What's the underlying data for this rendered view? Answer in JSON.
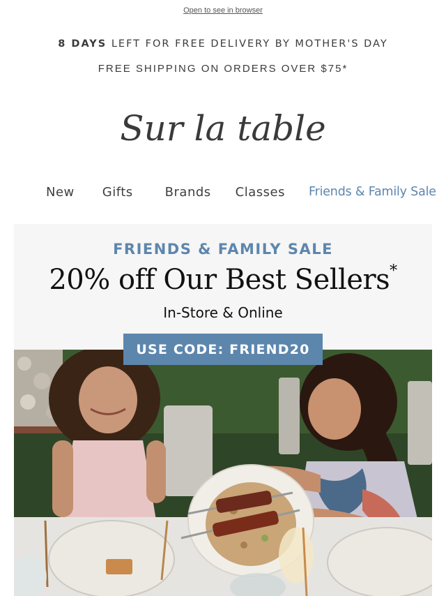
{
  "preheader": {
    "open_in_browser": "Open to see in browser"
  },
  "promo": {
    "days_bold": "8 DAYS",
    "days_rest": " LEFT FOR FREE DELIVERY BY MOTHER'S DAY",
    "shipping": "FREE SHIPPING ON ORDERS OVER $75*"
  },
  "brand": {
    "logo_text": "Sur la table"
  },
  "nav": {
    "items": [
      {
        "label": "New"
      },
      {
        "label": "Gifts"
      },
      {
        "label": "Brands"
      },
      {
        "label": "Classes"
      },
      {
        "label": "Friends & Family Sale"
      }
    ]
  },
  "hero": {
    "eyebrow": "FRIENDS & FAMILY SALE",
    "title": "20% off Our Best Sellers",
    "title_mark": "*",
    "subtitle": "In-Store & Online",
    "code_label": "USE CODE: FRIEND20"
  },
  "colors": {
    "accent": "#5d86ad",
    "text": "#3a3a3a",
    "panel": "#f6f6f6"
  }
}
